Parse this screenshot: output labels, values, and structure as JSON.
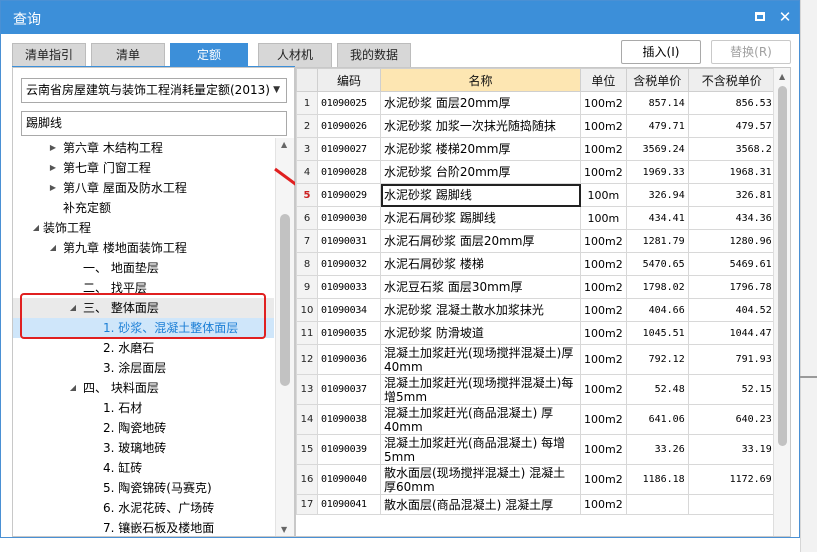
{
  "window": {
    "title": "查询"
  },
  "tabs": [
    {
      "label": "清单指引",
      "active": false
    },
    {
      "label": "清单",
      "active": false
    },
    {
      "label": "定额",
      "active": true
    },
    {
      "label": "人材机",
      "active": false
    },
    {
      "label": "我的数据",
      "active": false
    }
  ],
  "actions": {
    "insert_label": "插入(I)",
    "replace_label": "替换(R)"
  },
  "quota_select": {
    "value": "云南省房屋建筑与装饰工程消耗量定额(2013)"
  },
  "search": {
    "value": "踢脚线"
  },
  "tree": [
    {
      "label": "第六章 木结构工程",
      "arrow": "▶"
    },
    {
      "label": "第七章 门窗工程",
      "arrow": "▶"
    },
    {
      "label": "第八章 屋面及防水工程",
      "arrow": "▶"
    },
    {
      "label": "补充定额",
      "arrow": ""
    },
    {
      "label": "装饰工程",
      "arrow": "◢"
    },
    {
      "label": "第九章 楼地面装饰工程",
      "arrow": "◢"
    },
    {
      "label": "一、 地面垫层",
      "arrow": ""
    },
    {
      "label": "二、 找平层",
      "arrow": ""
    },
    {
      "label": "三、 整体面层",
      "arrow": "◢"
    },
    {
      "label": "1. 砂浆、混凝土整体面层",
      "arrow": ""
    },
    {
      "label": "2. 水磨石",
      "arrow": ""
    },
    {
      "label": "3. 涂层面层",
      "arrow": ""
    },
    {
      "label": "四、 块料面层",
      "arrow": "◢"
    },
    {
      "label": "1. 石材",
      "arrow": ""
    },
    {
      "label": "2. 陶瓷地砖",
      "arrow": ""
    },
    {
      "label": "3. 玻璃地砖",
      "arrow": ""
    },
    {
      "label": "4. 缸砖",
      "arrow": ""
    },
    {
      "label": "5. 陶瓷锦砖(马赛克)",
      "arrow": ""
    },
    {
      "label": "6. 水泥花砖、广场砖",
      "arrow": ""
    },
    {
      "label": "7. 镶嵌石板及楼地面",
      "arrow": ""
    }
  ],
  "grid": {
    "columns": [
      "编码",
      "名称",
      "单位",
      "含税单价",
      "不含税单价"
    ],
    "rows": [
      {
        "n": "1",
        "code": "01090025",
        "name": "水泥砂浆 面层20mm厚",
        "unit": "100m2",
        "tax": "857.14",
        "notax": "856.53"
      },
      {
        "n": "2",
        "code": "01090026",
        "name": "水泥砂浆 加浆一次抹光随捣随抹",
        "unit": "100m2",
        "tax": "479.71",
        "notax": "479.57"
      },
      {
        "n": "3",
        "code": "01090027",
        "name": "水泥砂浆 楼梯20mm厚",
        "unit": "100m2",
        "tax": "3569.24",
        "notax": "3568.2"
      },
      {
        "n": "4",
        "code": "01090028",
        "name": "水泥砂浆 台阶20mm厚",
        "unit": "100m2",
        "tax": "1969.33",
        "notax": "1968.31"
      },
      {
        "n": "5",
        "code": "01090029",
        "name": "水泥砂浆 踢脚线",
        "unit": "100m",
        "tax": "326.94",
        "notax": "326.81"
      },
      {
        "n": "6",
        "code": "01090030",
        "name": "水泥石屑砂浆 踢脚线",
        "unit": "100m",
        "tax": "434.41",
        "notax": "434.36"
      },
      {
        "n": "7",
        "code": "01090031",
        "name": "水泥石屑砂浆 面层20mm厚",
        "unit": "100m2",
        "tax": "1281.79",
        "notax": "1280.96"
      },
      {
        "n": "8",
        "code": "01090032",
        "name": "水泥石屑砂浆 楼梯",
        "unit": "100m2",
        "tax": "5470.65",
        "notax": "5469.61"
      },
      {
        "n": "9",
        "code": "01090033",
        "name": "水泥豆石浆 面层30mm厚",
        "unit": "100m2",
        "tax": "1798.02",
        "notax": "1796.78"
      },
      {
        "n": "10",
        "code": "01090034",
        "name": "水泥砂浆 混凝土散水加浆抹光",
        "unit": "100m2",
        "tax": "404.66",
        "notax": "404.52"
      },
      {
        "n": "11",
        "code": "01090035",
        "name": "水泥砂浆 防滑坡道",
        "unit": "100m2",
        "tax": "1045.51",
        "notax": "1044.47"
      },
      {
        "n": "12",
        "code": "01090036",
        "name": "混凝土加浆赶光(现场搅拌混凝土)厚40mm",
        "unit": "100m2",
        "tax": "792.12",
        "notax": "791.93"
      },
      {
        "n": "13",
        "code": "01090037",
        "name": "混凝土加浆赶光(现场搅拌混凝土)每增5mm",
        "unit": "100m2",
        "tax": "52.48",
        "notax": "52.15"
      },
      {
        "n": "14",
        "code": "01090038",
        "name": "混凝土加浆赶光(商品混凝土) 厚40mm",
        "unit": "100m2",
        "tax": "641.06",
        "notax": "640.23"
      },
      {
        "n": "15",
        "code": "01090039",
        "name": "混凝土加浆赶光(商品混凝土) 每增5mm",
        "unit": "100m2",
        "tax": "33.26",
        "notax": "33.19"
      },
      {
        "n": "16",
        "code": "01090040",
        "name": "散水面层(现场搅拌混凝土) 混凝土厚60mm",
        "unit": "100m2",
        "tax": "1186.18",
        "notax": "1172.69"
      },
      {
        "n": "17",
        "code": "01090041",
        "name": "散水面层(商品混凝土) 混凝土厚",
        "unit": "100m2",
        "tax": "",
        "notax": ""
      }
    ]
  },
  "icons": {
    "maximize": "maximize-icon",
    "close": "close-icon",
    "dropdown": "chevron-down-icon"
  },
  "colors": {
    "accent": "#3c8fd9",
    "selected_bg": "#cfe6fa",
    "annotation": "#e02020"
  }
}
